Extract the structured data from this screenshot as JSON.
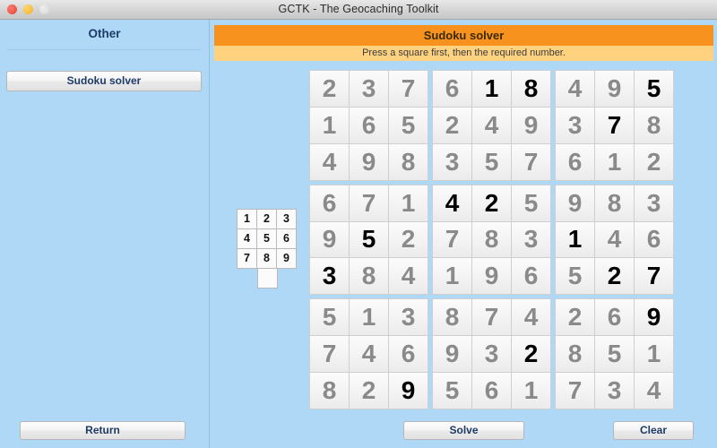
{
  "window": {
    "title": "GCTK - The Geocaching Toolkit",
    "controls": [
      {
        "name": "close",
        "color": "#ec5245"
      },
      {
        "name": "minimize",
        "color": "#f6bb3f"
      },
      {
        "name": "zoom",
        "color": "#dedede"
      }
    ]
  },
  "sidebar": {
    "title": "Other",
    "items": [
      {
        "label": "Sudoku solver"
      }
    ]
  },
  "main": {
    "banner_title": "Sudoku solver",
    "banner_subtitle": "Press a square first, then the required number."
  },
  "numpad": {
    "keys": [
      "1",
      "2",
      "3",
      "4",
      "5",
      "6",
      "7",
      "8",
      "9"
    ],
    "blank_key": ""
  },
  "grid": {
    "rows": [
      [
        {
          "v": "2",
          "given": false
        },
        {
          "v": "3",
          "given": false
        },
        {
          "v": "7",
          "given": false
        },
        {
          "v": "6",
          "given": false
        },
        {
          "v": "1",
          "given": true
        },
        {
          "v": "8",
          "given": true
        },
        {
          "v": "4",
          "given": false
        },
        {
          "v": "9",
          "given": false
        },
        {
          "v": "5",
          "given": true
        }
      ],
      [
        {
          "v": "1",
          "given": false
        },
        {
          "v": "6",
          "given": false
        },
        {
          "v": "5",
          "given": false
        },
        {
          "v": "2",
          "given": false
        },
        {
          "v": "4",
          "given": false
        },
        {
          "v": "9",
          "given": false
        },
        {
          "v": "3",
          "given": false
        },
        {
          "v": "7",
          "given": true
        },
        {
          "v": "8",
          "given": false
        }
      ],
      [
        {
          "v": "4",
          "given": false
        },
        {
          "v": "9",
          "given": false
        },
        {
          "v": "8",
          "given": false
        },
        {
          "v": "3",
          "given": false
        },
        {
          "v": "5",
          "given": false
        },
        {
          "v": "7",
          "given": false
        },
        {
          "v": "6",
          "given": false
        },
        {
          "v": "1",
          "given": false
        },
        {
          "v": "2",
          "given": false
        }
      ],
      [
        {
          "v": "6",
          "given": false
        },
        {
          "v": "7",
          "given": false
        },
        {
          "v": "1",
          "given": false
        },
        {
          "v": "4",
          "given": true
        },
        {
          "v": "2",
          "given": true
        },
        {
          "v": "5",
          "given": false
        },
        {
          "v": "9",
          "given": false
        },
        {
          "v": "8",
          "given": false
        },
        {
          "v": "3",
          "given": false
        }
      ],
      [
        {
          "v": "9",
          "given": false
        },
        {
          "v": "5",
          "given": true
        },
        {
          "v": "2",
          "given": false
        },
        {
          "v": "7",
          "given": false
        },
        {
          "v": "8",
          "given": false
        },
        {
          "v": "3",
          "given": false
        },
        {
          "v": "1",
          "given": true
        },
        {
          "v": "4",
          "given": false
        },
        {
          "v": "6",
          "given": false
        }
      ],
      [
        {
          "v": "3",
          "given": true
        },
        {
          "v": "8",
          "given": false
        },
        {
          "v": "4",
          "given": false
        },
        {
          "v": "1",
          "given": false
        },
        {
          "v": "9",
          "given": false
        },
        {
          "v": "6",
          "given": false
        },
        {
          "v": "5",
          "given": false
        },
        {
          "v": "2",
          "given": true
        },
        {
          "v": "7",
          "given": true
        }
      ],
      [
        {
          "v": "5",
          "given": false
        },
        {
          "v": "1",
          "given": false
        },
        {
          "v": "3",
          "given": false
        },
        {
          "v": "8",
          "given": false
        },
        {
          "v": "7",
          "given": false
        },
        {
          "v": "4",
          "given": false
        },
        {
          "v": "2",
          "given": false
        },
        {
          "v": "6",
          "given": false
        },
        {
          "v": "9",
          "given": true
        }
      ],
      [
        {
          "v": "7",
          "given": false
        },
        {
          "v": "4",
          "given": false
        },
        {
          "v": "6",
          "given": false
        },
        {
          "v": "9",
          "given": false
        },
        {
          "v": "3",
          "given": false
        },
        {
          "v": "2",
          "given": true
        },
        {
          "v": "8",
          "given": false
        },
        {
          "v": "5",
          "given": false
        },
        {
          "v": "1",
          "given": false
        }
      ],
      [
        {
          "v": "8",
          "given": false
        },
        {
          "v": "2",
          "given": false
        },
        {
          "v": "9",
          "given": true
        },
        {
          "v": "5",
          "given": false
        },
        {
          "v": "6",
          "given": false
        },
        {
          "v": "1",
          "given": false
        },
        {
          "v": "7",
          "given": false
        },
        {
          "v": "3",
          "given": false
        },
        {
          "v": "4",
          "given": false
        }
      ]
    ]
  },
  "footer": {
    "return_label": "Return",
    "solve_label": "Solve",
    "clear_label": "Clear"
  },
  "colors": {
    "background": "#aed8f5",
    "banner": "#f7921e",
    "subbanner": "#ffd27f",
    "solved_number": "#8a8a8a",
    "given_number": "#000000"
  }
}
